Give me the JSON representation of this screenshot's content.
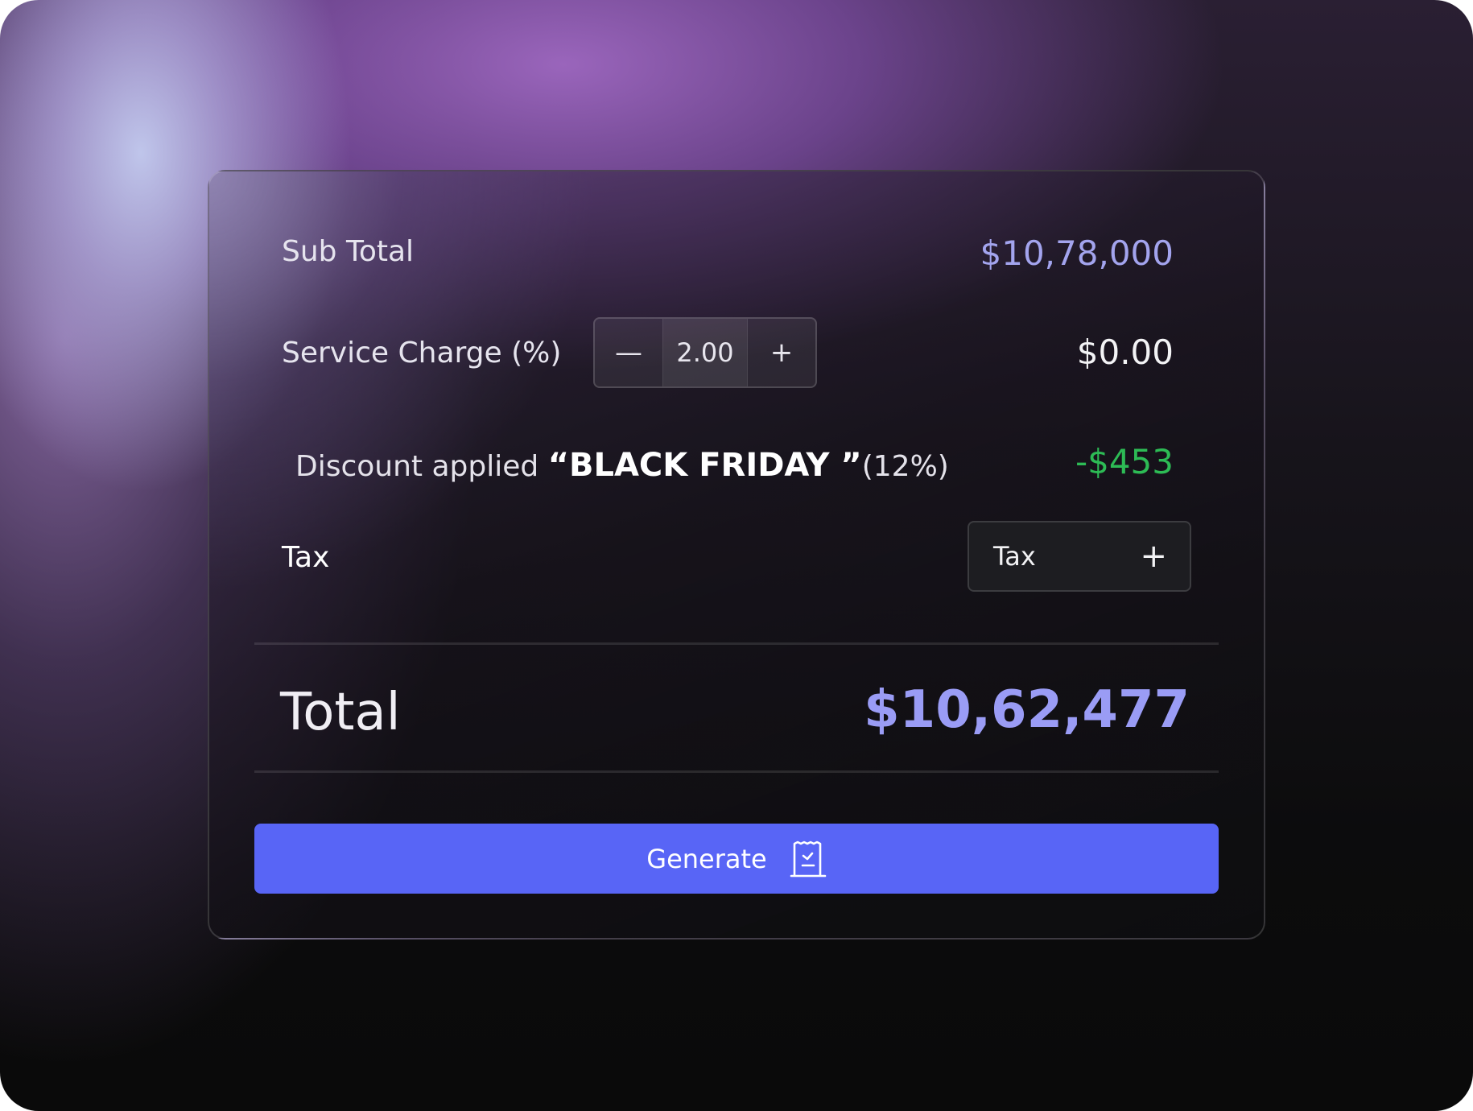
{
  "summary": {
    "subtotal_label": "Sub Total",
    "subtotal_value": "$10,78,000",
    "service_label": "Service Charge (%)",
    "service_stepper": {
      "decrement": "—",
      "value": "2.00",
      "increment": "+"
    },
    "service_value": "$0.00",
    "discount_prefix": "Discount applied ",
    "discount_code": "“BLACK FRIDAY ”",
    "discount_percent": "(12%)",
    "discount_value": "-$453",
    "tax_label": "Tax",
    "tax_button_label": "Tax",
    "tax_button_icon": "+",
    "total_label": "Total",
    "total_value": "$10,62,477"
  },
  "actions": {
    "generate_label": "Generate",
    "generate_icon": "receipt-icon"
  },
  "colors": {
    "accent": "#5865f6",
    "value_purple": "#a3a4ee",
    "total_purple": "#9a9cf5",
    "discount_green": "#2dbb55",
    "card_border": "#3a3644"
  }
}
